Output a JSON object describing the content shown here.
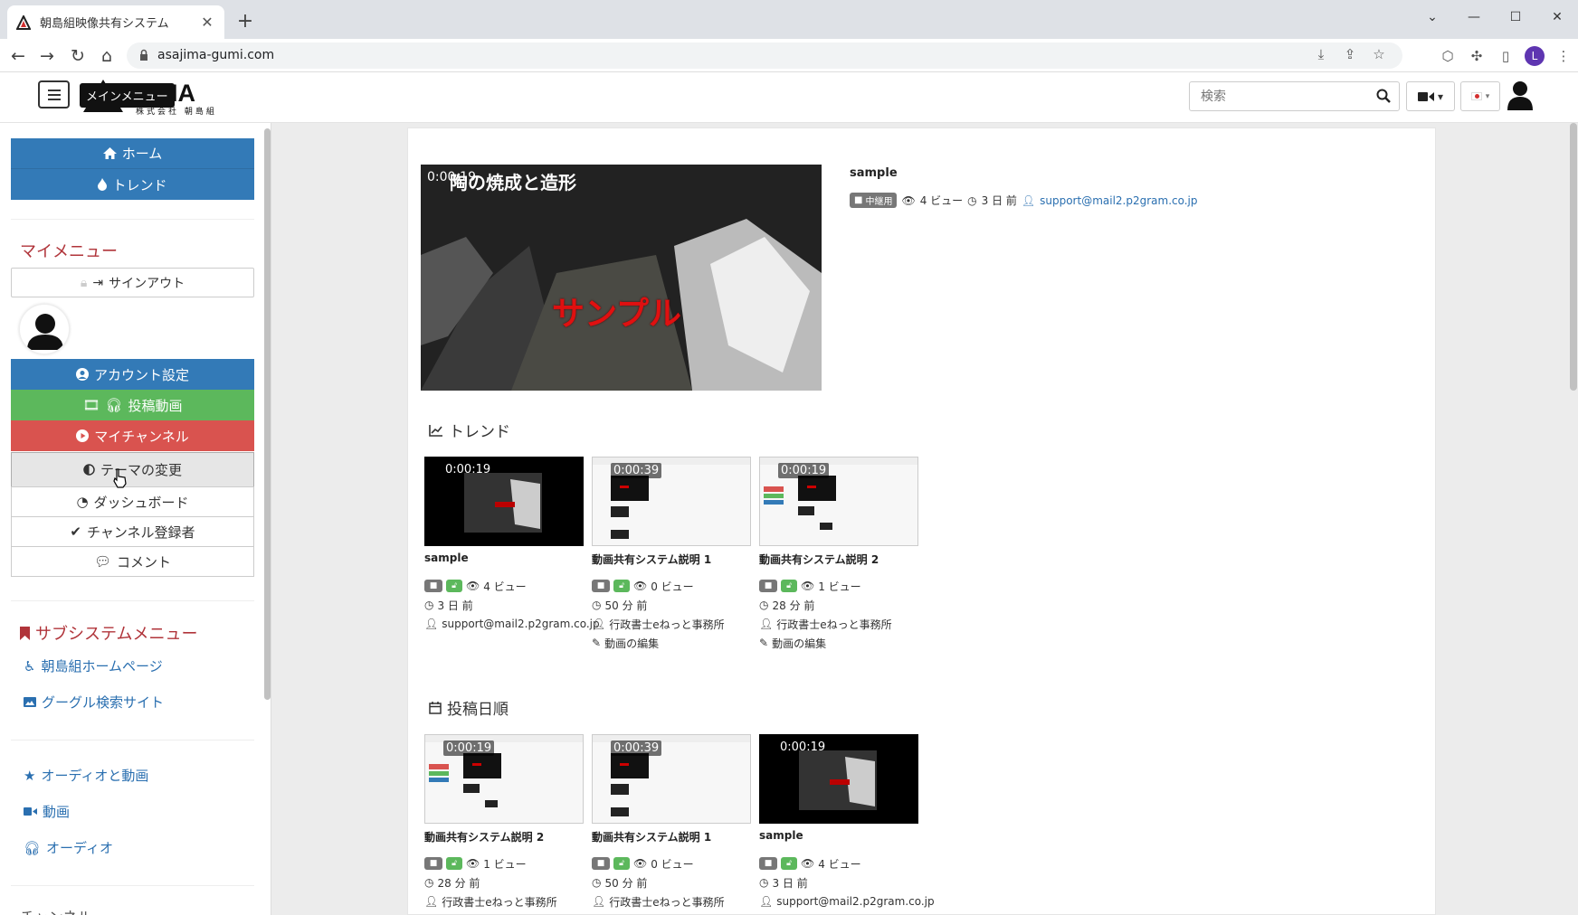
{
  "browser": {
    "tab_title": "朝島組映像共有システム",
    "url": "asajima-gumi.com",
    "profile_initial": "L"
  },
  "header": {
    "brand": "AJIMA",
    "brand_sub": "株式会社 朝島組",
    "tooltip": "メインメニュー",
    "search_placeholder": "検索"
  },
  "sidebar": {
    "home": "ホーム",
    "trend": "トレンド",
    "my_menu_title": "マイメニュー",
    "signout": "サインアウト",
    "account_settings": "アカウント設定",
    "posted_videos": "投稿動画",
    "my_channel": "マイチャンネル",
    "theme_change": "テーマの変更",
    "dashboard": "ダッシュボード",
    "channel_subscribers": "チャンネル登録者",
    "comments": "コメント",
    "subsystem_title": "サブシステムメニュー",
    "asajima_homepage": "朝島組ホームページ",
    "google_search": "グーグル検索サイト",
    "audio_and_video": "オーディオと動画",
    "video": "動画",
    "audio": "オーディオ",
    "channel_partial": "チャンネル"
  },
  "featured": {
    "duration": "0:00:19",
    "caption": "陶の焼成と造形",
    "overlay": "サンプル",
    "title": "sample",
    "badge": "中継用",
    "views": "4 ビュー",
    "time": "3 日 前",
    "author": "support@mail2.p2gram.co.jp"
  },
  "trend": {
    "heading": "トレンド",
    "cards": [
      {
        "duration": "0:00:19",
        "title": "sample",
        "views": "4 ビュー",
        "time": "3 日 前",
        "author": "support@mail2.p2gram.co.jp",
        "edit": ""
      },
      {
        "duration": "0:00:39",
        "title": "動画共有システム説明 1",
        "views": "0 ビュー",
        "time": "50 分 前",
        "author": "行政書士eねっと事務所",
        "edit": "動画の編集"
      },
      {
        "duration": "0:00:19",
        "title": "動画共有システム説明 2",
        "views": "1 ビュー",
        "time": "28 分 前",
        "author": "行政書士eねっと事務所",
        "edit": "動画の編集"
      }
    ]
  },
  "by_date": {
    "heading": "投稿日順",
    "cards": [
      {
        "duration": "0:00:19",
        "title": "動画共有システム説明 2",
        "views": "1 ビュー",
        "time": "28 分 前",
        "author": "行政書士eねっと事務所"
      },
      {
        "duration": "0:00:39",
        "title": "動画共有システム説明 1",
        "views": "0 ビュー",
        "time": "50 分 前",
        "author": "行政書士eねっと事務所"
      },
      {
        "duration": "0:00:19",
        "title": "sample",
        "views": "4 ビュー",
        "time": "3 日 前",
        "author": "support@mail2.p2gram.co.jp"
      }
    ]
  },
  "colors": {
    "primary": "#337ab7",
    "success": "#5cb85c",
    "danger": "#d9534f",
    "accent_red": "#b0343a",
    "link": "#2a6fb0"
  }
}
